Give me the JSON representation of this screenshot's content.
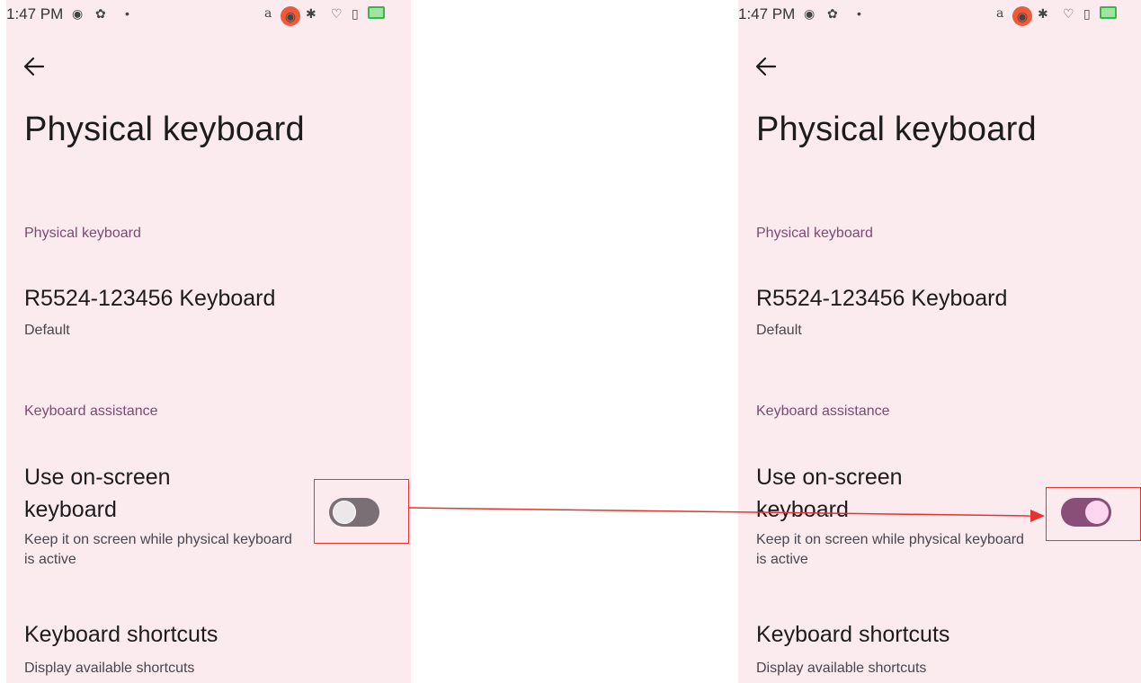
{
  "status_bar": {
    "time": "1:47 PM",
    "icons": [
      "record-icon",
      "gear-icon",
      "dot-icon",
      "a-icon",
      "cast-icon",
      "bluetooth-icon",
      "location-icon",
      "sim-icon",
      "battery-icon"
    ]
  },
  "screens": [
    {
      "id": "before",
      "title": "Physical keyboard",
      "section_keyboard": "Physical keyboard",
      "keyboard_name": "R5524-123456 Keyboard",
      "keyboard_layout": "Default",
      "section_assistance": "Keyboard assistance",
      "osk_title": "Use on-screen keyboard",
      "osk_subtitle": "Keep it on screen while physical keyboard is active",
      "osk_enabled": false,
      "shortcuts_title": "Keyboard shortcuts",
      "shortcuts_subtitle": "Display available shortcuts"
    },
    {
      "id": "after",
      "title": "Physical keyboard",
      "section_keyboard": "Physical keyboard",
      "keyboard_name": "R5524-123456 Keyboard",
      "keyboard_layout": "Default",
      "section_assistance": "Keyboard assistance",
      "osk_title": "Use on-screen keyboard",
      "osk_subtitle": "Keep it on screen while physical keyboard is active",
      "osk_enabled": true,
      "shortcuts_title": "Keyboard shortcuts",
      "shortcuts_subtitle": "Display available shortcuts"
    }
  ],
  "colors": {
    "background": "#fcebee",
    "section_header": "#7b4a73",
    "toggle_off_track": "#7a6f75",
    "toggle_on_track": "#8a4f78",
    "toggle_on_thumb": "#ffd6f0",
    "annotation_red": "#e3342f"
  }
}
